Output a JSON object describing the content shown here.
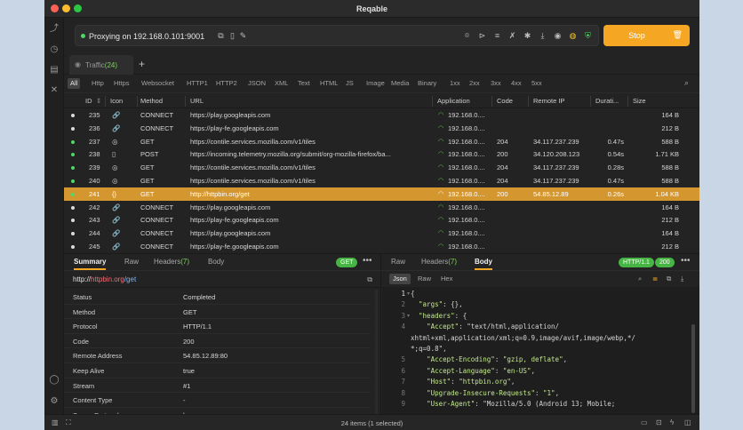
{
  "window": {
    "title": "Reqable"
  },
  "proxy": {
    "status": "Proxying on 192.168.0.101:9001",
    "stop_label": "Stop"
  },
  "tabs": {
    "traffic_label": "Traffic",
    "traffic_count": "(24)"
  },
  "filters": [
    "All",
    "Http",
    "Https",
    "Websocket",
    "HTTP1",
    "HTTP2",
    "JSON",
    "XML",
    "Text",
    "HTML",
    "JS",
    "Image",
    "Media",
    "Binary",
    "1xx",
    "2xx",
    "3xx",
    "4xx",
    "5xx"
  ],
  "columns": {
    "id": "ID",
    "icon": "Icon",
    "method": "Method",
    "url": "URL",
    "application": "Application",
    "code": "Code",
    "remote_ip": "Remote IP",
    "duration": "Durati...",
    "size": "Size"
  },
  "rows": [
    {
      "id": "235",
      "icon": "🔗",
      "method": "CONNECT",
      "url": "https://play.googleapis.com",
      "app": "192.168.0....",
      "code": "",
      "ip": "",
      "dur": "",
      "size": "164 B",
      "dot": "#dcdcdc"
    },
    {
      "id": "236",
      "icon": "🔗",
      "method": "CONNECT",
      "url": "https://play-fe.googleapis.com",
      "app": "192.168.0....",
      "code": "",
      "ip": "",
      "dur": "",
      "size": "212 B",
      "dot": "#dcdcdc"
    },
    {
      "id": "237",
      "icon": "◎",
      "method": "GET",
      "url": "https://contile.services.mozilla.com/v1/tiles",
      "app": "192.168.0....",
      "code": "204",
      "ip": "34.117.237.239",
      "dur": "0.47s",
      "size": "588 B",
      "dot": "#4cd964"
    },
    {
      "id": "238",
      "icon": "▯",
      "method": "POST",
      "url": "https://incoming.telemetry.mozilla.org/submit/org-mozilla-firefox/ba...",
      "app": "192.168.0....",
      "code": "200",
      "ip": "34.120.208.123",
      "dur": "0.54s",
      "size": "1.71 KB",
      "dot": "#4cd964"
    },
    {
      "id": "239",
      "icon": "◎",
      "method": "GET",
      "url": "https://contile.services.mozilla.com/v1/tiles",
      "app": "192.168.0....",
      "code": "204",
      "ip": "34.117.237.239",
      "dur": "0.28s",
      "size": "588 B",
      "dot": "#4cd964"
    },
    {
      "id": "240",
      "icon": "◎",
      "method": "GET",
      "url": "https://contile.services.mozilla.com/v1/tiles",
      "app": "192.168.0....",
      "code": "204",
      "ip": "34.117.237.239",
      "dur": "0.47s",
      "size": "588 B",
      "dot": "#4cd964"
    },
    {
      "id": "241",
      "icon": "{}",
      "method": "GET",
      "url": "http://httpbin.org/get",
      "app": "192.168.0....",
      "code": "200",
      "ip": "54.85.12.89",
      "dur": "0.26s",
      "size": "1.04 KB",
      "dot": "#4cd964",
      "selected": true
    },
    {
      "id": "242",
      "icon": "🔗",
      "method": "CONNECT",
      "url": "https://play.googleapis.com",
      "app": "192.168.0....",
      "code": "",
      "ip": "",
      "dur": "",
      "size": "164 B",
      "dot": "#dcdcdc"
    },
    {
      "id": "243",
      "icon": "🔗",
      "method": "CONNECT",
      "url": "https://play-fe.googleapis.com",
      "app": "192.168.0....",
      "code": "",
      "ip": "",
      "dur": "",
      "size": "212 B",
      "dot": "#dcdcdc"
    },
    {
      "id": "244",
      "icon": "🔗",
      "method": "CONNECT",
      "url": "https://play.googleapis.com",
      "app": "192.168.0....",
      "code": "",
      "ip": "",
      "dur": "",
      "size": "164 B",
      "dot": "#dcdcdc"
    },
    {
      "id": "245",
      "icon": "🔗",
      "method": "CONNECT",
      "url": "https://play-fe.googleapis.com",
      "app": "192.168.0....",
      "code": "",
      "ip": "",
      "dur": "",
      "size": "212 B",
      "dot": "#dcdcdc"
    }
  ],
  "left_panel": {
    "tabs": {
      "summary": "Summary",
      "raw": "Raw",
      "headers": "Headers",
      "headers_count": "(7)",
      "body": "Body"
    },
    "method_pill": "GET",
    "url": {
      "scheme": "http://",
      "host": "httpbin.org",
      "path": "/get"
    },
    "fields": [
      {
        "key": "Status",
        "value": "Completed"
      },
      {
        "key": "Method",
        "value": "GET"
      },
      {
        "key": "Protocol",
        "value": "HTTP/1.1"
      },
      {
        "key": "Code",
        "value": "200"
      },
      {
        "key": "Remote Address",
        "value": "54.85.12.89:80"
      },
      {
        "key": "Keep Alive",
        "value": "true"
      },
      {
        "key": "Stream",
        "value": "#1"
      },
      {
        "key": "Content Type",
        "value": "-"
      },
      {
        "key": "Server Protocol",
        "value": "h..."
      }
    ]
  },
  "right_panel": {
    "tabs": {
      "raw": "Raw",
      "headers": "Headers",
      "headers_count": "(7)",
      "body": "Body"
    },
    "protocol_pill": "HTTP/1.1",
    "code_pill": "200",
    "subtabs": [
      "Json",
      "Raw",
      "Hex"
    ],
    "lines": [
      {
        "n": "1",
        "fold": true,
        "text": "{"
      },
      {
        "n": "2",
        "text": "  \"args\": {},"
      },
      {
        "n": "3",
        "fold": true,
        "text": "  \"headers\": {"
      },
      {
        "n": "4",
        "text": "    \"Accept\": \"text/html,application/"
      },
      {
        "n": "",
        "text": "xhtml+xml,application/xml;q=0.9,image/avif,image/webp,*/"
      },
      {
        "n": "",
        "text": "*;q=0.8\","
      },
      {
        "n": "5",
        "text": "    \"Accept-Encoding\": \"gzip, deflate\","
      },
      {
        "n": "6",
        "text": "    \"Accept-Language\": \"en-US\","
      },
      {
        "n": "7",
        "text": "    \"Host\": \"httpbin.org\","
      },
      {
        "n": "8",
        "text": "    \"Upgrade-Insecure-Requests\": \"1\","
      },
      {
        "n": "9",
        "text": "    \"User-Agent\": \"Mozilla/5.0 (Android 13; Mobile;"
      }
    ]
  },
  "status": {
    "text": "24 items (1 selected)"
  },
  "colors": {
    "accent": "#f5a623",
    "selected_row": "#d4962f",
    "success": "#4cd964"
  }
}
